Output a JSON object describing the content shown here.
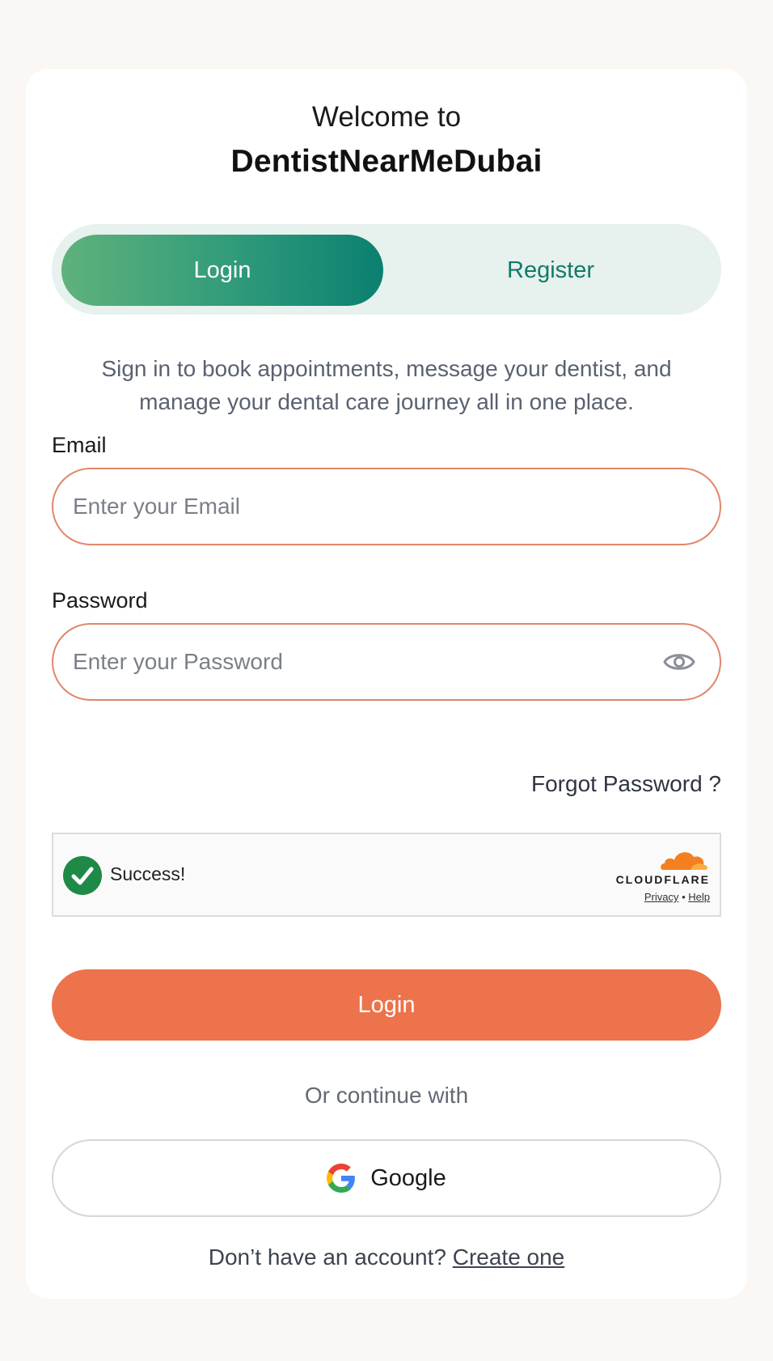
{
  "header": {
    "welcome": "Welcome to",
    "brand": "DentistNearMeDubai"
  },
  "tabs": [
    {
      "label": "Login",
      "active": true
    },
    {
      "label": "Register",
      "active": false
    }
  ],
  "subtitle": "Sign in to book appointments, message your dentist, and manage your dental care journey all in one place.",
  "form": {
    "email_label": "Email",
    "email_placeholder": "Enter your Email",
    "email_value": "",
    "password_label": "Password",
    "password_placeholder": "Enter your Password",
    "password_value": "",
    "forgot_label": "Forgot Password ?"
  },
  "captcha": {
    "status": "Success!",
    "brand": "CLOUDFLARE",
    "privacy": "Privacy",
    "separator": "•",
    "help": "Help"
  },
  "actions": {
    "login_label": "Login",
    "or_text": "Or continue with",
    "google_label": "Google"
  },
  "footer": {
    "prompt": "Don’t have an account?",
    "create_label": "Create one"
  },
  "colors": {
    "accent_orange": "#ec734c",
    "accent_green": "#0b8070",
    "tab_bg": "#e7f1ee",
    "success_green": "#1f8a47"
  }
}
